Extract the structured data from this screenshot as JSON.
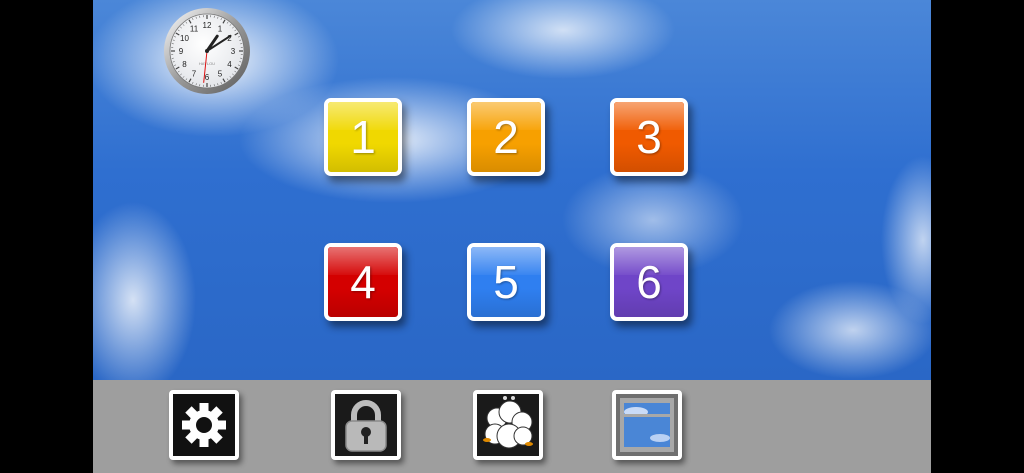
{
  "clock": {
    "numerals": [
      "12",
      "1",
      "2",
      "3",
      "4",
      "5",
      "6",
      "7",
      "8",
      "9",
      "10",
      "11"
    ],
    "brand": "HAYLOU",
    "time": {
      "hour": 1,
      "minute": 9,
      "second": 31
    }
  },
  "tiles": [
    {
      "label": "1",
      "color": "#f0d800"
    },
    {
      "label": "2",
      "color": "#f7a000"
    },
    {
      "label": "3",
      "color": "#f05a00"
    },
    {
      "label": "4",
      "color": "#d40000"
    },
    {
      "label": "5",
      "color": "#2f7ff0"
    },
    {
      "label": "6",
      "color": "#6f45c8"
    }
  ],
  "dock": {
    "items": [
      {
        "icon": "gear-icon"
      },
      {
        "icon": "padlock-icon"
      },
      {
        "icon": "sheep-icon"
      },
      {
        "icon": "window-icon"
      }
    ]
  }
}
